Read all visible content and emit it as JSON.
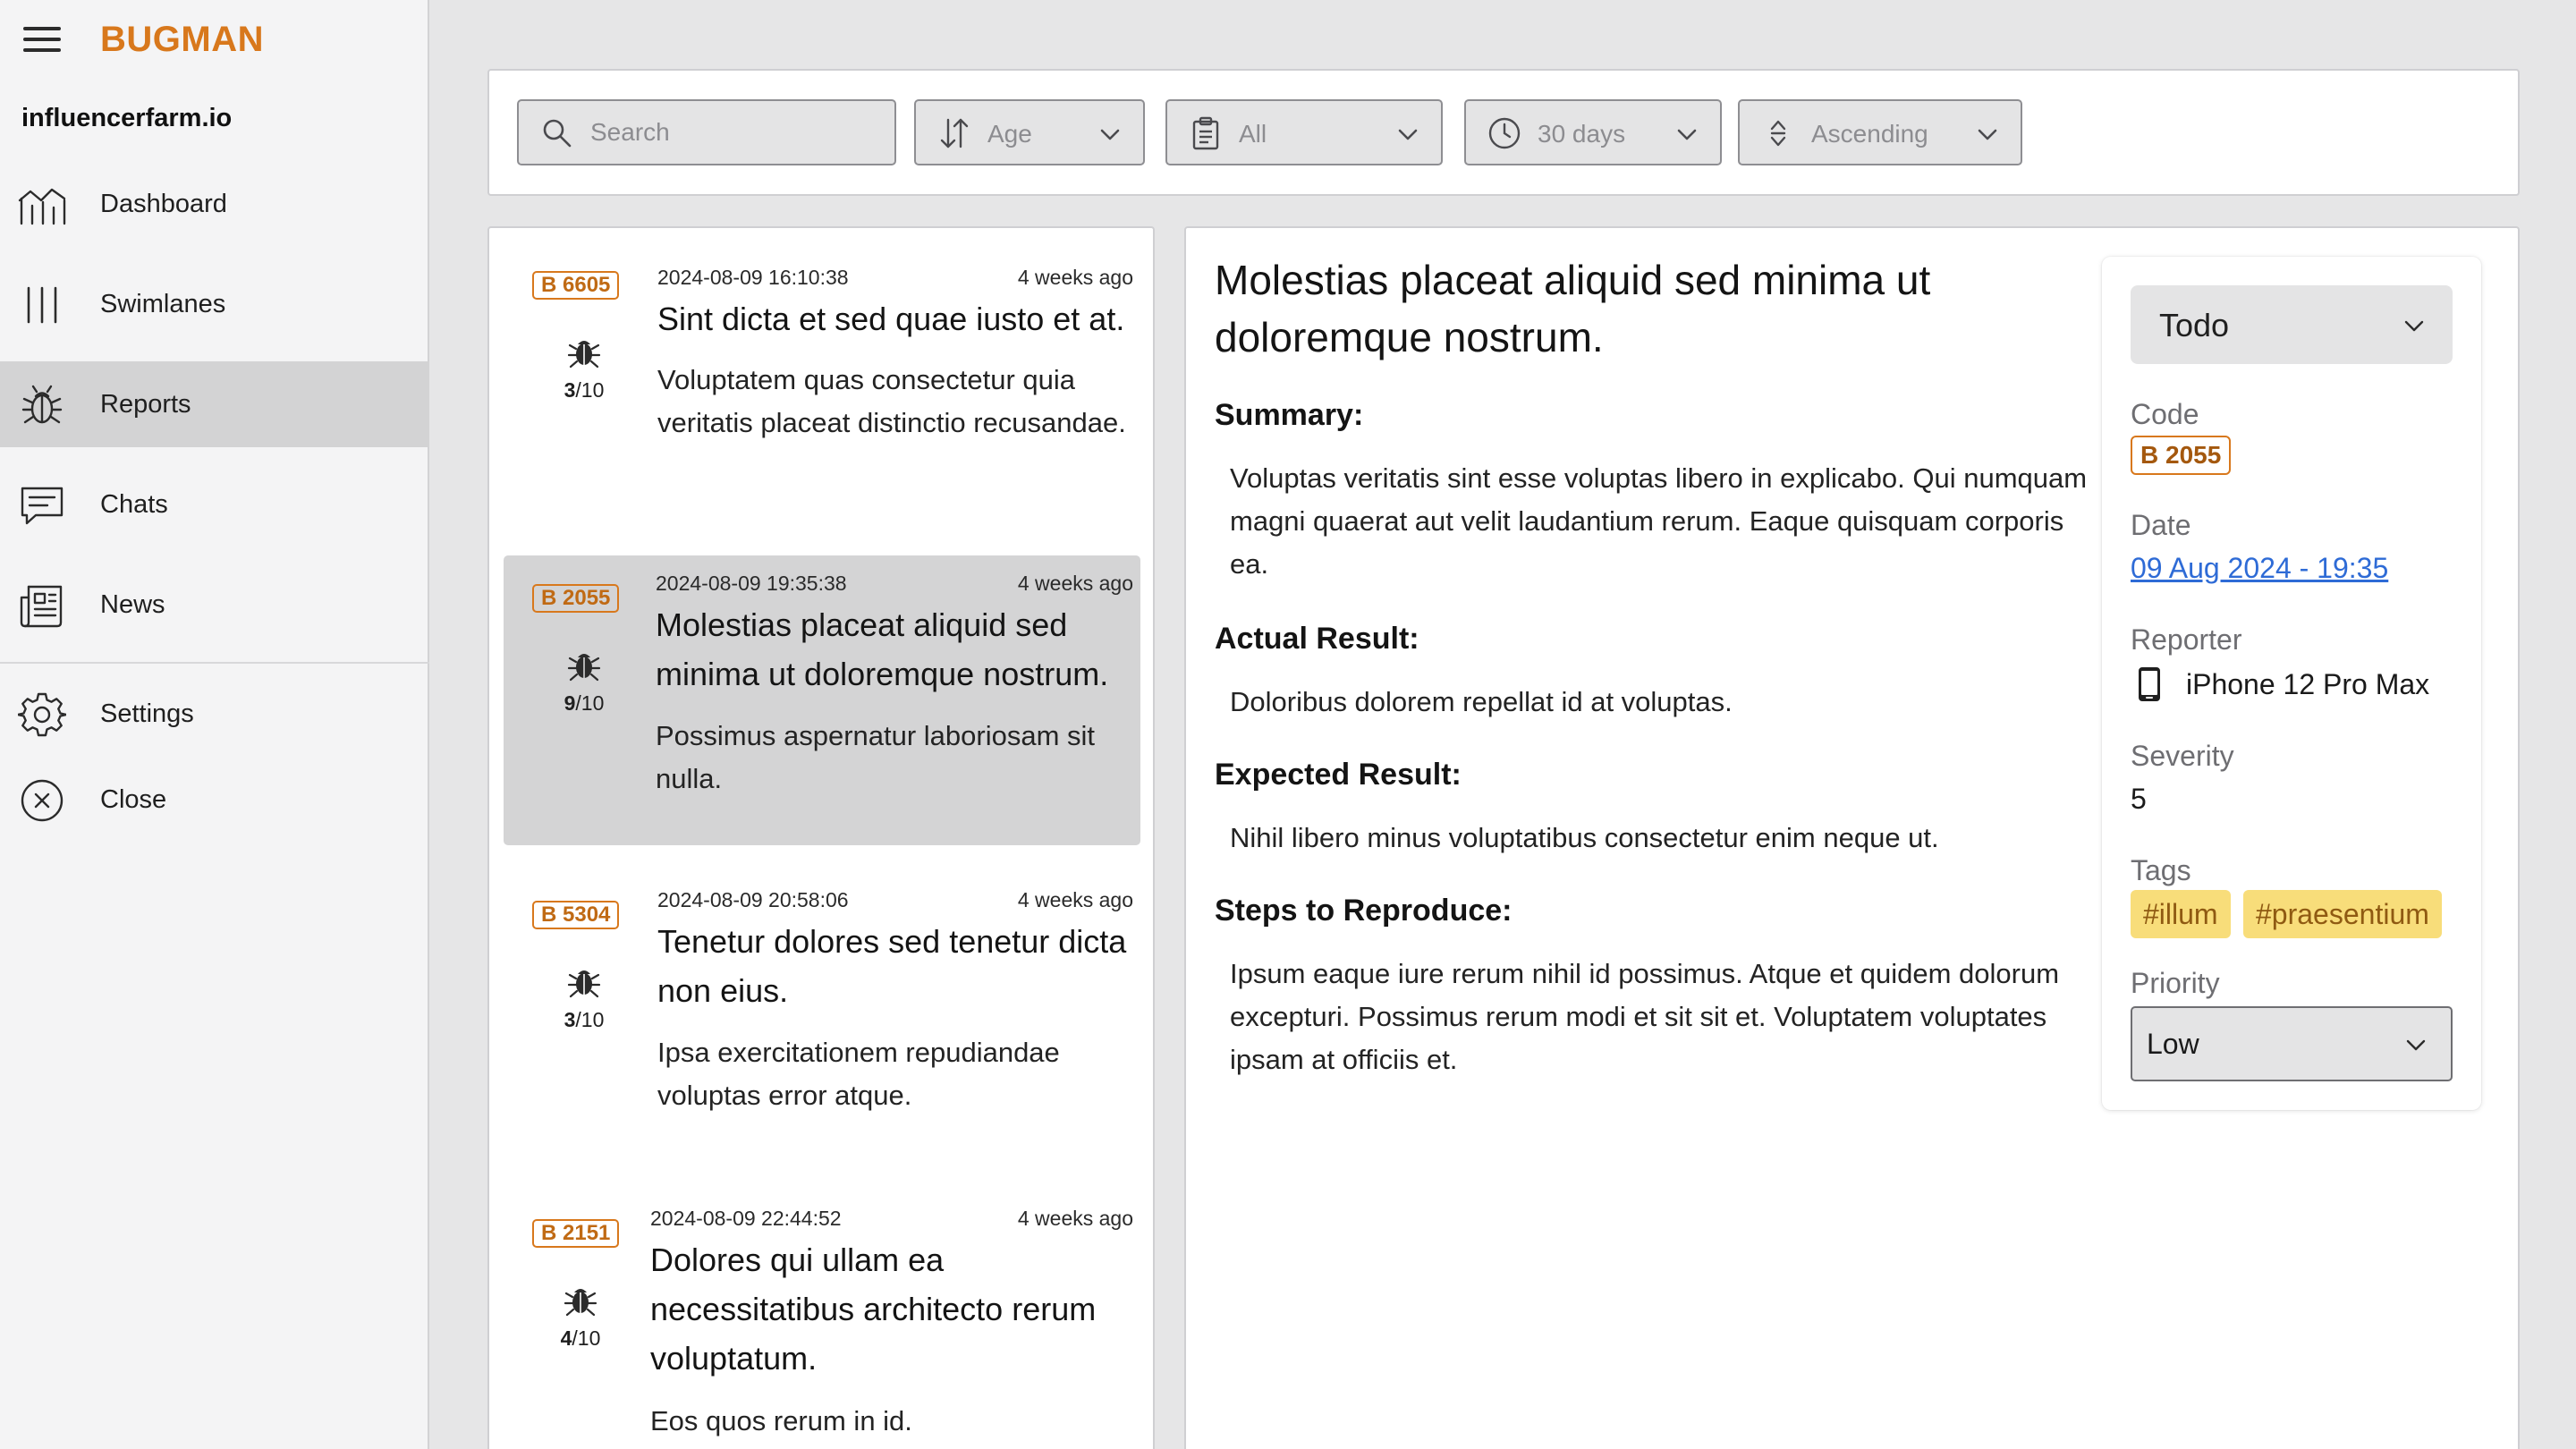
{
  "app": {
    "brand": "BUGMAN",
    "org": "influencerfarm.io"
  },
  "sidebar": {
    "items": [
      {
        "label": "Dashboard",
        "icon": "chart-line-icon"
      },
      {
        "label": "Swimlanes",
        "icon": "swimlanes-icon"
      },
      {
        "label": "Reports",
        "icon": "bug-icon",
        "active": true
      },
      {
        "label": "Chats",
        "icon": "chat-icon"
      },
      {
        "label": "News",
        "icon": "newspaper-icon"
      }
    ],
    "bottom": [
      {
        "label": "Settings",
        "icon": "gear-icon"
      },
      {
        "label": "Close",
        "icon": "close-circle-icon"
      }
    ]
  },
  "filters": {
    "search_placeholder": "Search",
    "sort_field": "Age",
    "category": "All",
    "period": "30 days",
    "order": "Ascending"
  },
  "reports": [
    {
      "code": "B 6605",
      "severity": "3",
      "severity_max": "/10",
      "date": "2024-08-09 16:10:38",
      "ago": "4 weeks ago",
      "title": "Sint dicta et sed quae iusto et at.",
      "description": "Voluptatem quas consectetur quia veritatis placeat distinctio recusandae."
    },
    {
      "code": "B 2055",
      "severity": "9",
      "severity_max": "/10",
      "date": "2024-08-09 19:35:38",
      "ago": "4 weeks ago",
      "title": "Molestias placeat aliquid sed minima ut doloremque nostrum.",
      "description": "Possimus aspernatur laboriosam sit nulla.",
      "selected": true
    },
    {
      "code": "B 5304",
      "severity": "3",
      "severity_max": "/10",
      "date": "2024-08-09 20:58:06",
      "ago": "4 weeks ago",
      "title": "Tenetur dolores sed tenetur dicta non eius.",
      "description": "Ipsa exercitationem repudiandae voluptas error atque."
    },
    {
      "code": "B 2151",
      "severity": "4",
      "severity_max": "/10",
      "date": "2024-08-09 22:44:52",
      "ago": "4 weeks ago",
      "title": "Dolores qui ullam ea necessitatibus architecto rerum voluptatum.",
      "description": "Eos quos rerum in id."
    }
  ],
  "detail": {
    "title": "Molestias placeat aliquid sed minima ut doloremque nostrum.",
    "summary_heading": "Summary:",
    "summary": "Voluptas veritatis sint esse voluptas libero in explicabo. Qui numquam magni quaerat aut velit laudantium rerum. Eaque quisquam corporis ea.",
    "actual_heading": "Actual Result:",
    "actual": "Doloribus dolorem repellat id at voluptas.",
    "expected_heading": "Expected Result:",
    "expected": "Nihil libero minus voluptatibus consectetur enim neque ut.",
    "steps_heading": "Steps to Reproduce:",
    "steps": "Ipsum eaque iure rerum nihil id possimus. Atque et quidem dolorum excepturi. Possimus rerum modi et sit sit et. Voluptatem voluptates ipsam at officiis et.",
    "meta": {
      "status": "Todo",
      "code_label": "Code",
      "code": "B 2055",
      "date_label": "Date",
      "date": "09 Aug 2024 - 19:35",
      "reporter_label": "Reporter",
      "reporter": "iPhone 12 Pro Max",
      "severity_label": "Severity",
      "severity": "5",
      "tags_label": "Tags",
      "tags": [
        "#illum",
        "#praesentium"
      ],
      "priority_label": "Priority",
      "priority": "Low"
    }
  },
  "colors": {
    "brand": "#d8781c",
    "tag_bg": "#f8dd7a",
    "link": "#2e6bd6",
    "active_nav": "#d3d3d4"
  }
}
